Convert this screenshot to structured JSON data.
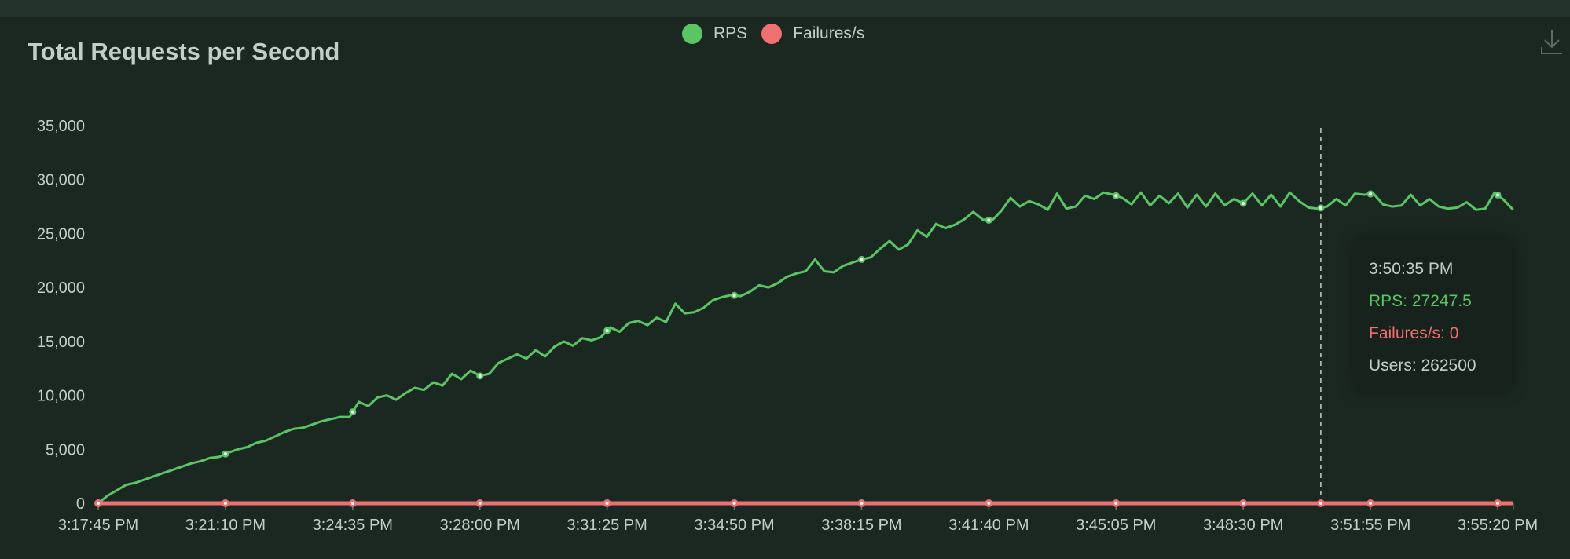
{
  "chart_data": {
    "type": "line",
    "title": "Total Requests per Second",
    "xlabel": "",
    "ylabel": "",
    "ylim": [
      0,
      35000
    ],
    "y_ticks": [
      "0",
      "5,000",
      "10,000",
      "15,000",
      "20,000",
      "25,000",
      "30,000",
      "35,000"
    ],
    "y_tick_values": [
      0,
      5000,
      10000,
      15000,
      20000,
      25000,
      30000,
      35000
    ],
    "x_ticks": [
      "3:17:45 PM",
      "3:21:10 PM",
      "3:24:35 PM",
      "3:28:00 PM",
      "3:31:25 PM",
      "3:34:50 PM",
      "3:38:15 PM",
      "3:41:40 PM",
      "3:45:05 PM",
      "3:48:30 PM",
      "3:51:55 PM",
      "3:55:20 PM"
    ],
    "x_tick_interval_s": 205,
    "x_range_s": [
      0,
      2280
    ],
    "sample_interval_s": 15,
    "grid": false,
    "legend_position": "top-center",
    "series": [
      {
        "name": "RPS",
        "color": "#5bc465",
        "values": [
          0,
          700,
          1200,
          1700,
          1900,
          2200,
          2500,
          2800,
          3100,
          3400,
          3700,
          3900,
          4200,
          4300,
          4700,
          5000,
          5200,
          5600,
          5800,
          6200,
          6600,
          6900,
          7000,
          7300,
          7600,
          7800,
          8000,
          8000,
          9400,
          9000,
          9800,
          10000,
          9600,
          10200,
          10700,
          10500,
          11200,
          10900,
          12000,
          11500,
          12300,
          11800,
          12000,
          13000,
          13400,
          13800,
          13400,
          14200,
          13600,
          14500,
          15000,
          14600,
          15300,
          15100,
          15400,
          16300,
          15900,
          16700,
          16900,
          16500,
          17200,
          16800,
          18500,
          17600,
          17700,
          18100,
          18800,
          19100,
          19300,
          19200,
          19600,
          20200,
          20000,
          20400,
          21000,
          21300,
          21500,
          22600,
          21500,
          21400,
          22000,
          22300,
          22600,
          22800,
          23600,
          24300,
          23500,
          24000,
          25300,
          24700,
          25900,
          25500,
          25800,
          26300,
          27000,
          26300,
          26200,
          27100,
          28300,
          27500,
          28000,
          27700,
          27200,
          28700,
          27300,
          27500,
          28500,
          28200,
          28800,
          28600,
          28300,
          27700,
          28800,
          27600,
          28500,
          27800,
          28700,
          27400,
          28600,
          27500,
          28700,
          27600,
          28200,
          27800,
          28700,
          27600,
          28600,
          27500,
          28800,
          28000,
          27400,
          27300,
          27500,
          28200,
          27600,
          28700,
          28600,
          28700,
          27700,
          27500,
          27600,
          28600,
          27600,
          28200,
          27500,
          27300,
          27400,
          27900,
          27200,
          27300,
          28800,
          28100,
          27200
        ]
      },
      {
        "name": "Failures/s",
        "color": "#ee7070",
        "values": [
          0,
          0,
          0,
          0,
          0,
          0,
          0,
          0,
          0,
          0,
          0,
          0,
          0,
          0,
          0,
          0,
          0,
          0,
          0,
          0,
          0,
          0,
          0,
          0,
          0,
          0,
          0,
          0,
          0,
          0,
          0,
          0,
          0,
          0,
          0,
          0,
          0,
          0,
          0,
          0,
          0,
          0,
          0,
          0,
          0,
          0,
          0,
          0,
          0,
          0,
          0,
          0,
          0,
          0,
          0,
          0,
          0,
          0,
          0,
          0,
          0,
          0,
          0,
          0,
          0,
          0,
          0,
          0,
          0,
          0,
          0,
          0,
          0,
          0,
          0,
          0,
          0,
          0,
          0,
          0,
          0,
          0,
          0,
          0,
          0,
          0,
          0,
          0,
          0,
          0,
          0,
          0,
          0,
          0,
          0,
          0,
          0,
          0,
          0,
          0,
          0,
          0,
          0,
          0,
          0,
          0,
          0,
          0,
          0,
          0,
          0,
          0,
          0,
          0,
          0,
          0,
          0,
          0,
          0,
          0,
          0,
          0,
          0,
          0,
          0,
          0,
          0,
          0,
          0,
          0,
          0,
          0,
          0,
          0,
          0,
          0,
          0,
          0,
          0,
          0,
          0,
          0,
          0,
          0,
          0,
          0,
          0,
          0,
          0,
          0,
          0,
          0,
          0
        ]
      }
    ],
    "hover": {
      "time_s": 1970,
      "time": "3:50:35 PM",
      "rps": "RPS: 27247.5",
      "failures": "Failures/s: 0",
      "users": "Users: 262500"
    }
  },
  "icons": {
    "download": "download-icon"
  }
}
